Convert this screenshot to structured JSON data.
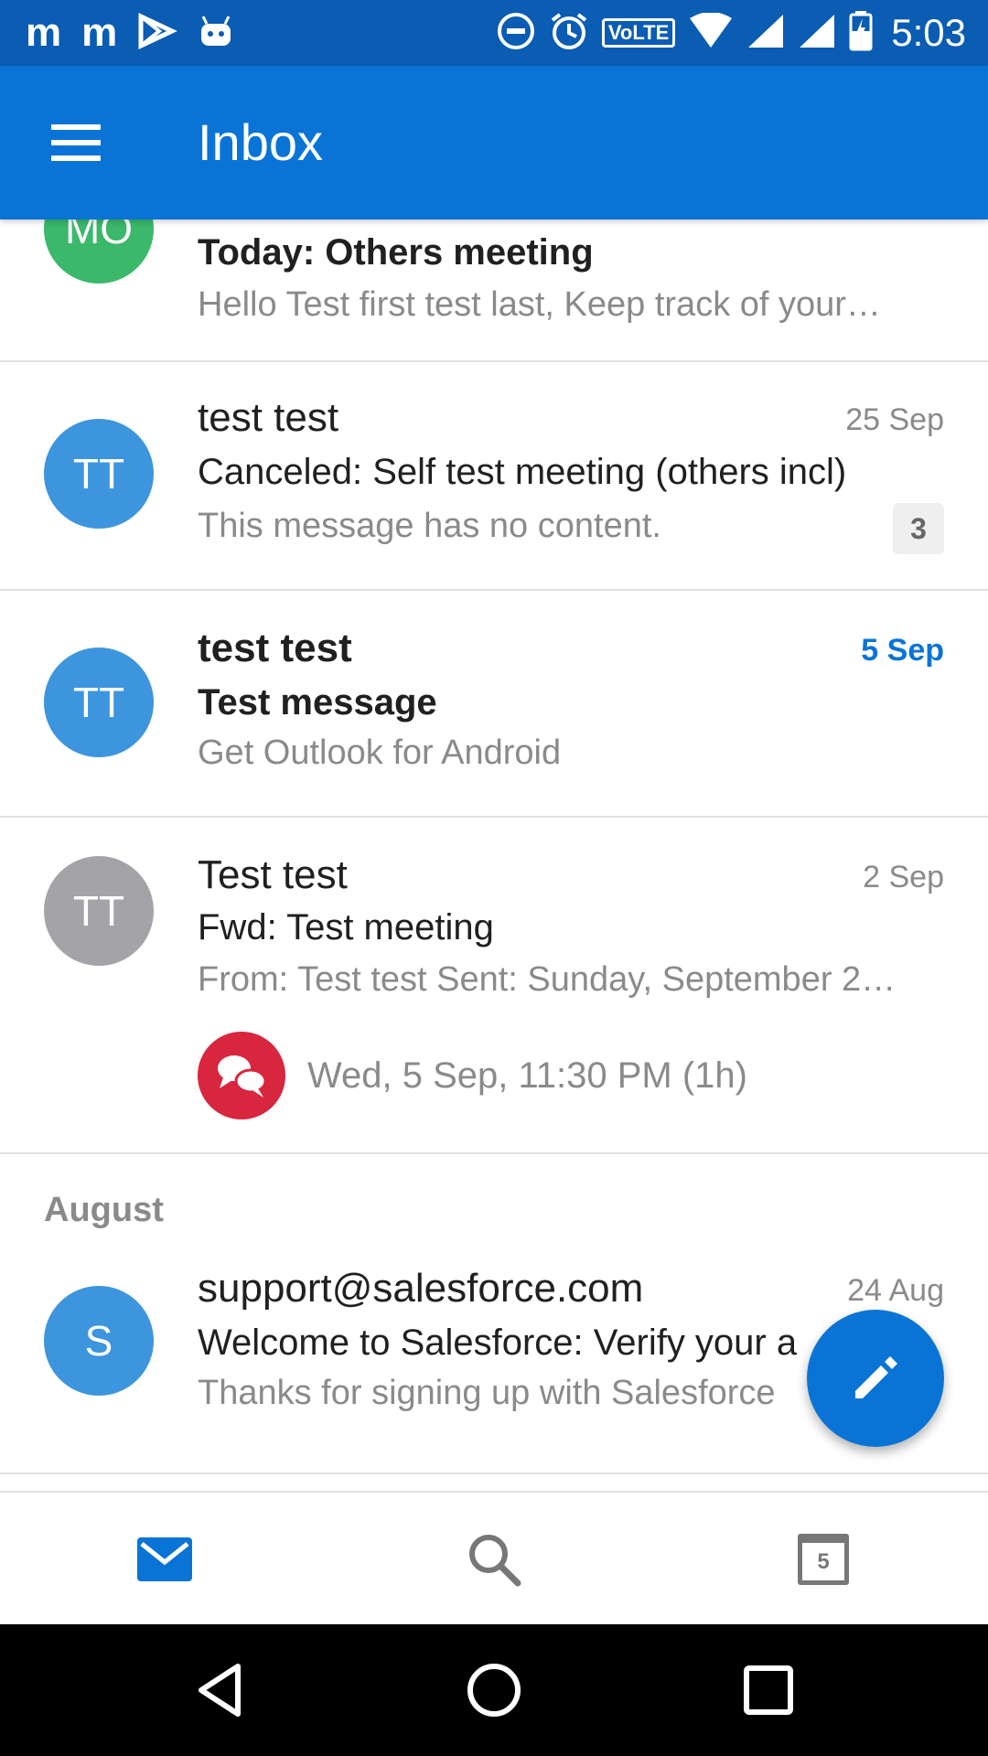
{
  "status_bar": {
    "left_icons": [
      "m",
      "m"
    ],
    "volte_label": "VoLTE",
    "time": "5:03"
  },
  "app_bar": {
    "title": "Inbox"
  },
  "messages": [
    {
      "avatar_initials": "MO",
      "avatar_color": "#3bb86a",
      "sender": "",
      "subject": "Today: Others meeting",
      "preview": "Hello Test first test last, Keep track of your…",
      "unread": true
    },
    {
      "avatar_initials": "TT",
      "avatar_color": "#3d95dd",
      "sender": "test test",
      "date": "25 Sep",
      "subject": "Canceled: Self test meeting (others incl)",
      "preview": "This message has no content.",
      "thread_count": "3",
      "unread": false
    },
    {
      "avatar_initials": "TT",
      "avatar_color": "#3d95dd",
      "sender": "test test",
      "date": "5 Sep",
      "subject": "Test message",
      "preview": "Get Outlook for Android",
      "unread": true
    },
    {
      "avatar_initials": "TT",
      "avatar_color": "#a4a4a8",
      "sender": "Test test",
      "date": "2 Sep",
      "subject": "Fwd: Test meeting",
      "preview": "From: Test test Sent: Sunday, September 2…",
      "event": "Wed, 5 Sep, 11:30 PM (1h)",
      "unread": false
    }
  ],
  "section_august": {
    "header": "August",
    "message": {
      "avatar_initials": "S",
      "avatar_color": "#3d95dd",
      "sender": "support@salesforce.com",
      "date": "24 Aug",
      "subject": "Welcome to Salesforce: Verify your a",
      "preview": "Thanks for signing up with Salesforce",
      "unread": false
    }
  },
  "bottom_nav": {
    "items": [
      "mail-icon",
      "search-icon",
      "calendar-icon"
    ],
    "calendar_day": "5",
    "active_color": "#0a74d6"
  },
  "colors": {
    "accent": "#0a74d6",
    "status_bar": "#0b5cb3",
    "event_icon": "#d7263d"
  }
}
